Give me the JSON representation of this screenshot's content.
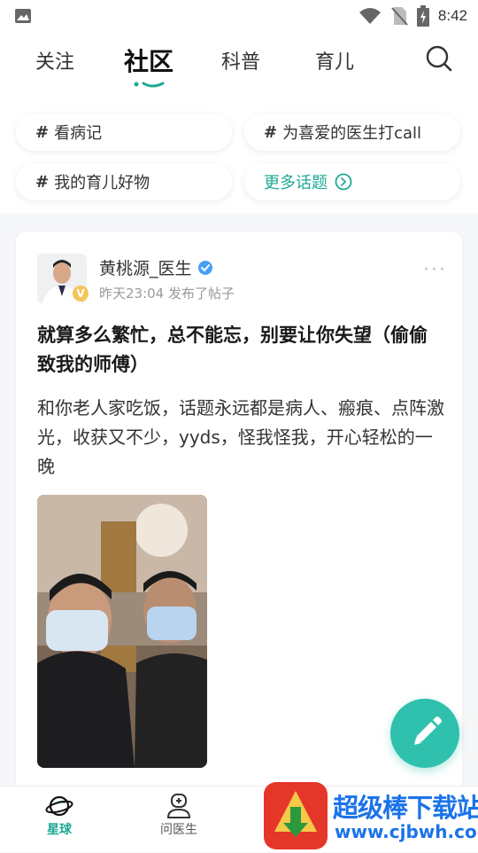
{
  "status_bar": {
    "time": "8:42",
    "icons": [
      "image-icon",
      "wifi-icon",
      "no-sim-icon",
      "battery-charging-icon"
    ]
  },
  "top_nav": {
    "tabs": [
      {
        "label": "关注",
        "active": false
      },
      {
        "label": "社区",
        "active": true
      },
      {
        "label": "科普",
        "active": false
      },
      {
        "label": "育儿",
        "active": false
      }
    ],
    "search_icon": "search-icon",
    "accent": "#1ea995"
  },
  "topics": {
    "items": [
      {
        "label": "看病记"
      },
      {
        "label": "为喜爱的医生打call"
      },
      {
        "label": "我的育儿好物"
      }
    ],
    "more_label": "更多话题",
    "hash": "#"
  },
  "post": {
    "author": "黄桃源_医生",
    "verified_badge": "V",
    "meta": "昨天23:04 发布了帖子",
    "title": "就算多么繁忙，总不能忘，别要让你失望（偷偷致我的师傅）",
    "body": "和你老人家吃饭，话题永远都是病人、瘢痕、点阵激光，收获又不少，yyds，怪我怪我，开心轻松的一晚",
    "more": "···"
  },
  "fab": {
    "icon": "pencil-icon",
    "color": "#2fc1ad"
  },
  "bottom_nav": {
    "items": [
      {
        "label": "星球",
        "icon": "planet-icon",
        "active": true
      },
      {
        "label": "问医生",
        "icon": "doctor-icon",
        "active": false
      }
    ]
  },
  "watermark": {
    "title": "超级棒下载站",
    "url": "www.cjbwh.com"
  }
}
